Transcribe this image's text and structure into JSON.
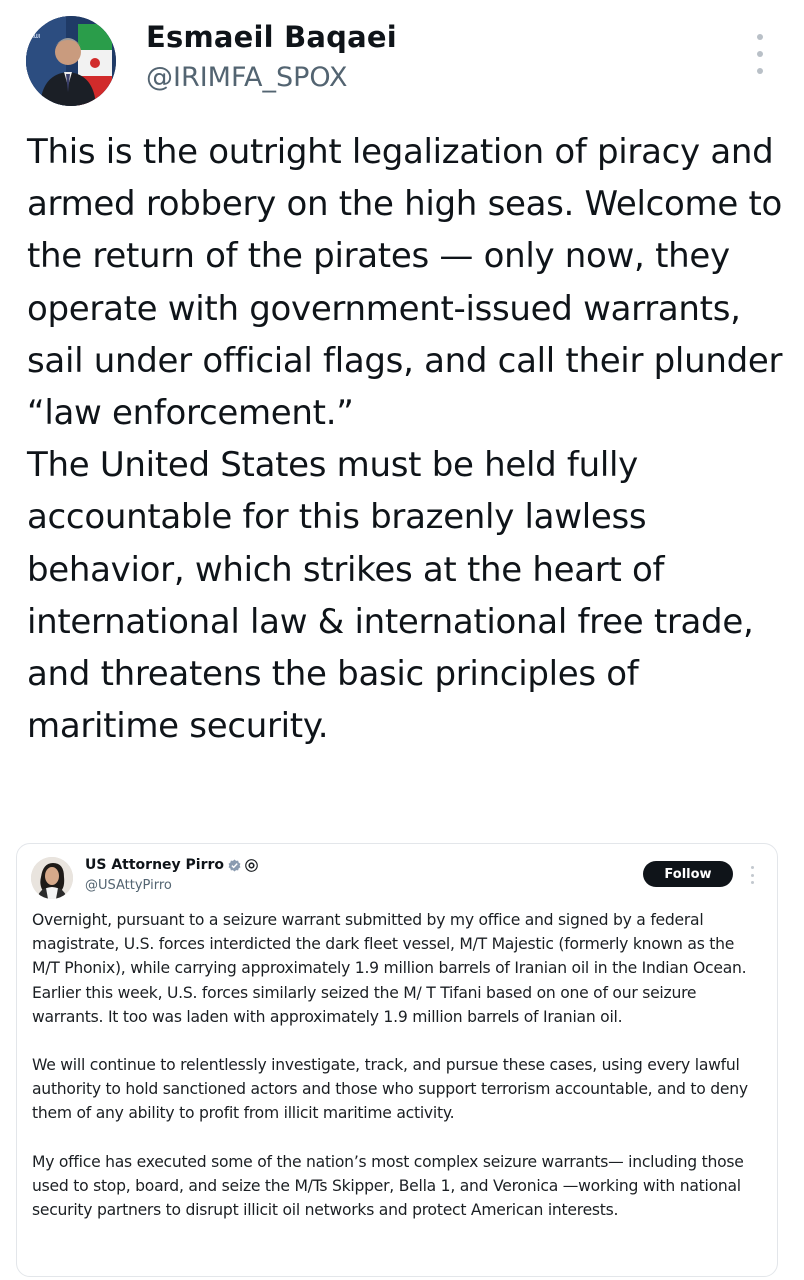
{
  "tweet": {
    "author_name": "Esmaeil Baqaei",
    "author_handle": "@IRIMFA_SPOX",
    "more_icon": "more-vertical-icon",
    "paragraphs": [
      "This is the outright legalization of piracy and armed robbery on the high seas. Welcome to the return of the pirates — only now, they operate with government-issued warrants, sail under official flags, and call their plunder “law enforcement.”",
      "The United States must be held fully accountable for this brazenly lawless behavior, which strikes at the heart of international law & international free trade, and threatens the basic principles of maritime security."
    ]
  },
  "quoted": {
    "author_name": "US Attorney Pirro",
    "author_handle": "@USAttyPirro",
    "badges": [
      "verified-icon",
      "government-icon"
    ],
    "follow_label": "Follow",
    "paragraphs": [
      "Overnight, pursuant to a seizure warrant submitted by my office and signed by a federal magistrate, U.S. forces interdicted the dark fleet vessel, M/T Majestic (formerly known as the M/T Phonix), while carrying approximately 1.9 million barrels of Iranian oil in the Indian Ocean. Earlier this week, U.S. forces similarly seized the M/ T Tifani based on one of our seizure warrants. It too was laden with approximately 1.9 million barrels of Iranian oil.",
      "We will continue to relentlessly investigate, track, and pursue these cases, using every lawful authority to hold sanctioned actors and those who support terrorism accountable, and to deny them of any ability to profit from illicit maritime activity.",
      "My office has executed some of the nation’s most complex seizure warrants— including those used to stop, board, and seize the M/Ts Skipper, Bella 1, and Veronica —working with national security partners to disrupt illicit oil networks and protect American interests."
    ]
  },
  "colors": {
    "text": "#0f1419",
    "secondary": "#536471",
    "follow_bg": "#0f1419",
    "verified_blue": "#8a9bb0"
  }
}
